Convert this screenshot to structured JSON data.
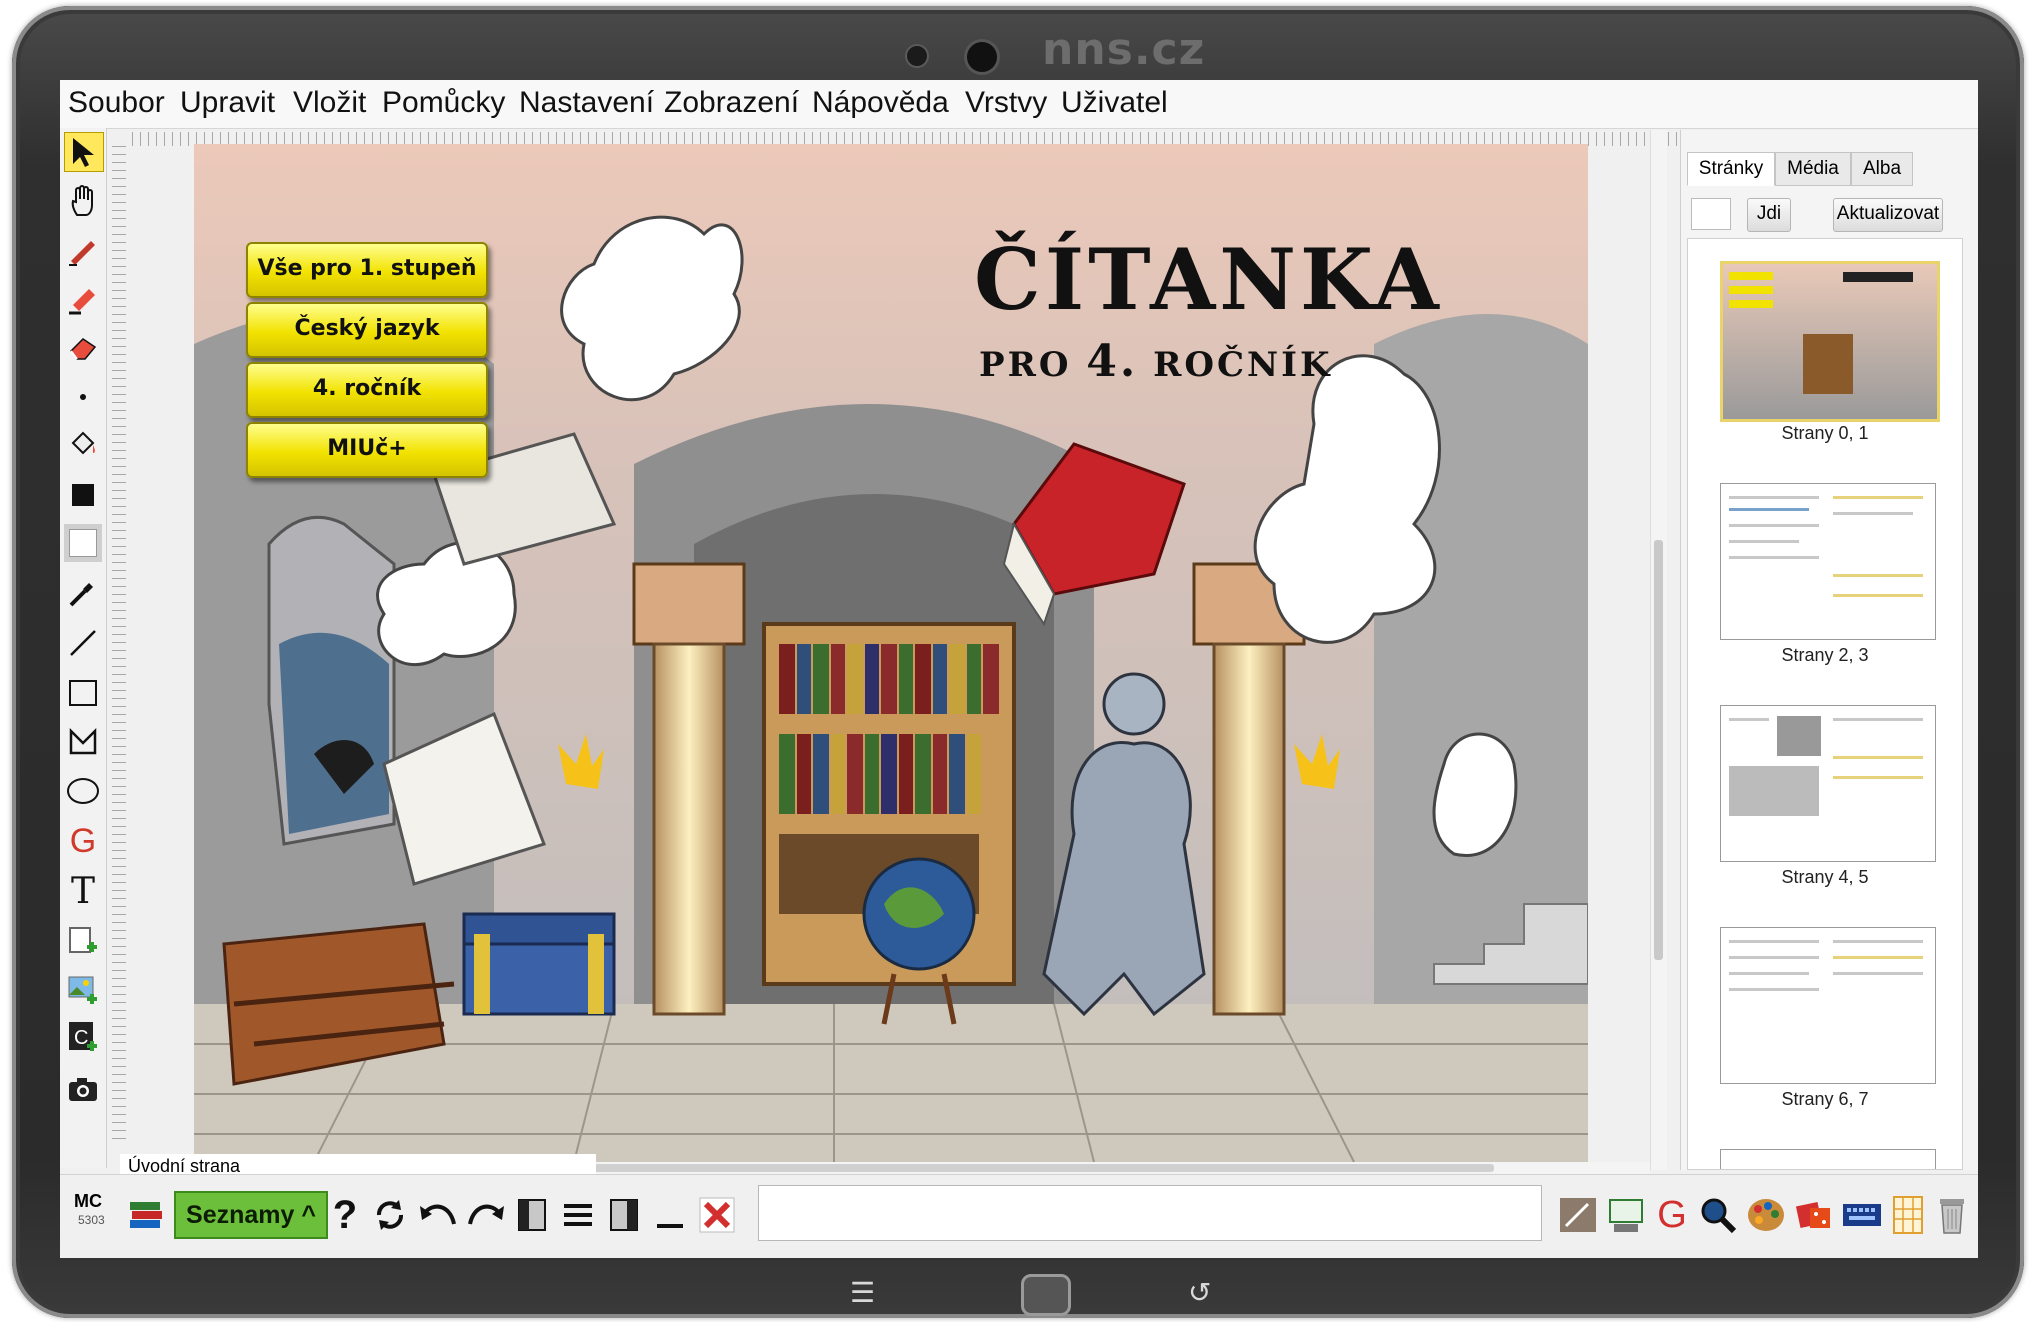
{
  "device": {
    "brand": "nns.cz"
  },
  "menu": [
    "Soubor",
    "Upravit",
    "Vložit",
    "Pomůcky",
    "Nastavení",
    "Zobrazení",
    "Nápověda",
    "Vrstvy",
    "Uživatel"
  ],
  "tools": [
    "select-arrow-icon",
    "hand-icon",
    "pen-icon",
    "highlighter-icon",
    "eraser-icon",
    "dot-icon",
    "fill-bucket-icon",
    "color-square-icon",
    "line-style-icon",
    "eyedropper-icon",
    "line-icon",
    "rectangle-icon",
    "polygon-icon",
    "ellipse-icon",
    "geogebra-icon",
    "text-icon",
    "add-page-icon",
    "insert-image-icon",
    "insert-media-icon",
    "camera-icon"
  ],
  "canvas": {
    "buttons": [
      "Vše pro 1. stupeň",
      "Český jazyk",
      "4. ročník",
      "MIUč+"
    ],
    "title": "ČÍTANKA",
    "subtitle_pro": "PRO",
    "subtitle_num": "4.",
    "subtitle_rocnik": "ROČNÍK",
    "page_label": "Úvodní strana"
  },
  "sidebar": {
    "tabs": [
      "Stránky",
      "Média",
      "Alba"
    ],
    "goto_label": "Jdi",
    "refresh_label": "Aktualizovat",
    "thumbnails": [
      "Strany 0, 1",
      "Strany 2, 3",
      "Strany 4, 5",
      "Strany 6, 7"
    ]
  },
  "bottom": {
    "mc_label": "MC",
    "mc_code": "5303",
    "lists_label": "Seznamy ^",
    "help_label": "?"
  },
  "colors": {
    "accent_yellow": "#f2e200",
    "lists_green": "#6bbf3a",
    "selection_yellow": "#ffe85c"
  }
}
